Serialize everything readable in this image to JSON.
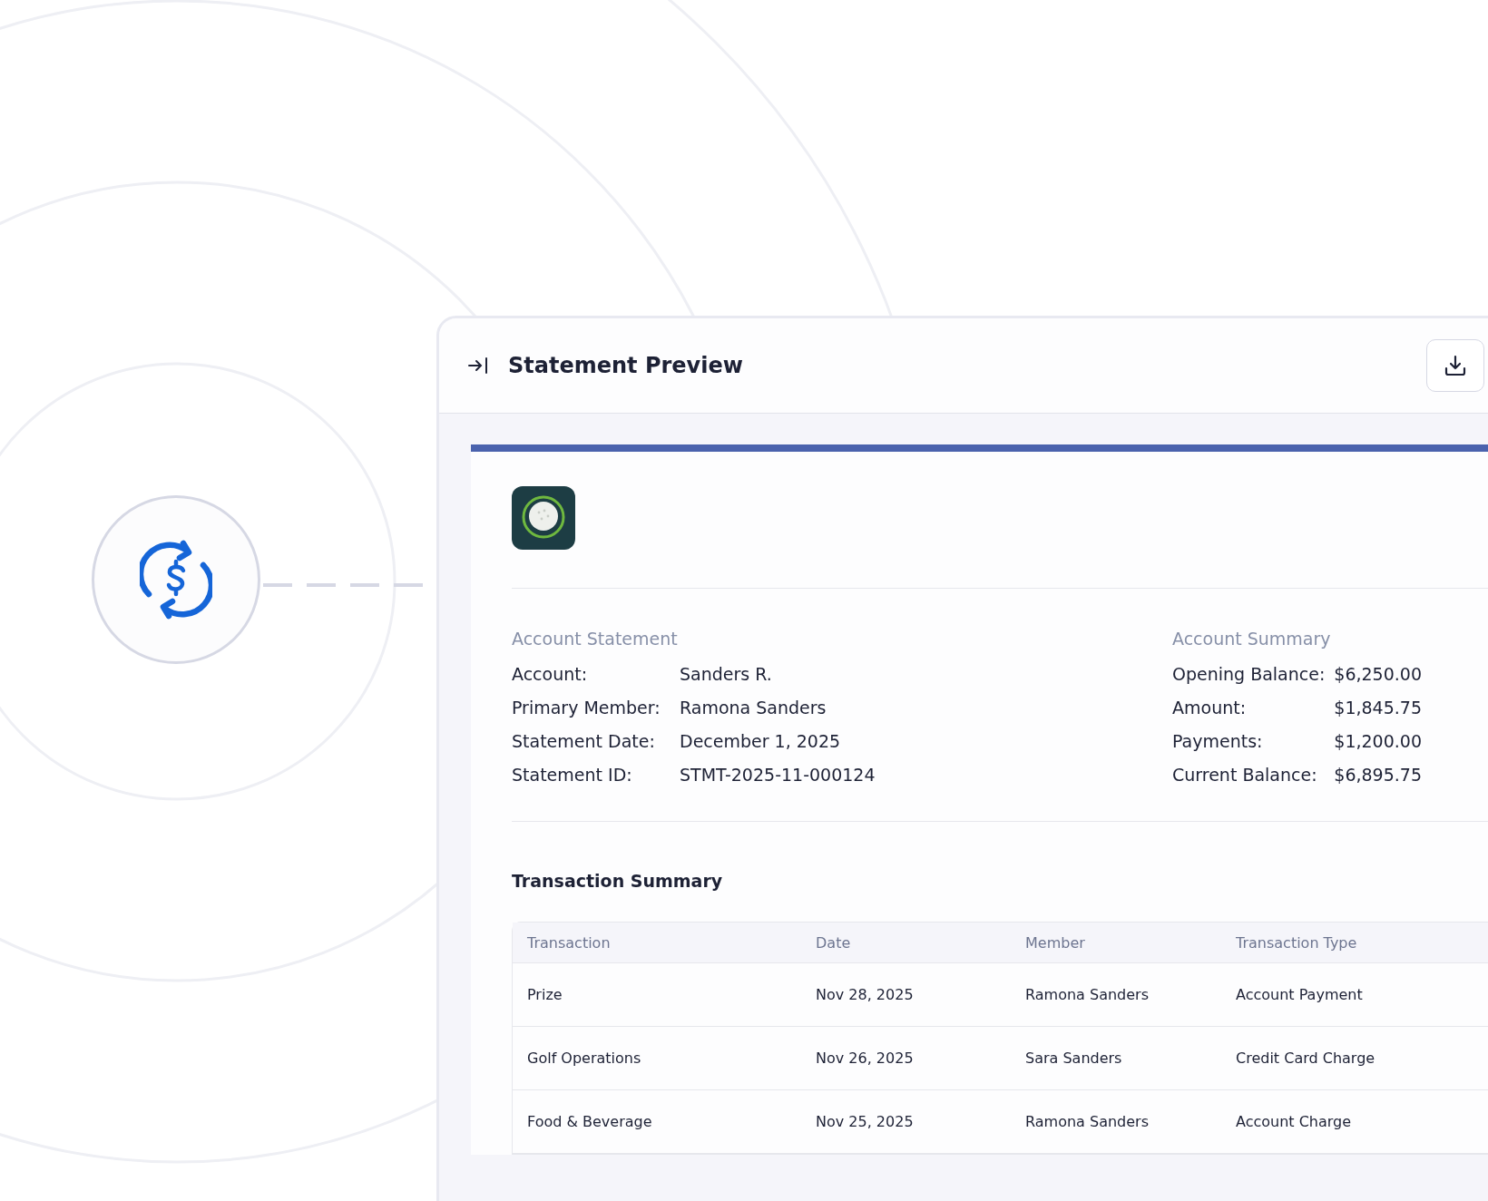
{
  "panel": {
    "title": "Statement Preview"
  },
  "account_statement": {
    "heading": "Account Statement",
    "fields": [
      {
        "label": "Account:",
        "value": "Sanders R."
      },
      {
        "label": "Primary Member:",
        "value": "Ramona Sanders"
      },
      {
        "label": "Statement Date:",
        "value": "December 1, 2025"
      },
      {
        "label": "Statement ID:",
        "value": "STMT-2025-11-000124"
      }
    ]
  },
  "account_summary": {
    "heading": "Account Summary",
    "fields": [
      {
        "label": "Opening Balance:",
        "value": "$6,250.00"
      },
      {
        "label": "Amount:",
        "value": "$1,845.75"
      },
      {
        "label": "Payments:",
        "value": "$1,200.00"
      },
      {
        "label": "Current Balance:",
        "value": "$6,895.75"
      }
    ]
  },
  "transactions": {
    "heading": "Transaction Summary",
    "columns": [
      "Transaction",
      "Date",
      "Member",
      "Transaction Type"
    ],
    "rows": [
      [
        "Prize",
        "Nov 28, 2025",
        "Ramona Sanders",
        "Account Payment"
      ],
      [
        "Golf Operations",
        "Nov 26, 2025",
        "Sara Sanders",
        "Credit Card Charge"
      ],
      [
        "Food & Beverage",
        "Nov 25, 2025",
        "Ramona Sanders",
        "Account Charge"
      ]
    ]
  }
}
